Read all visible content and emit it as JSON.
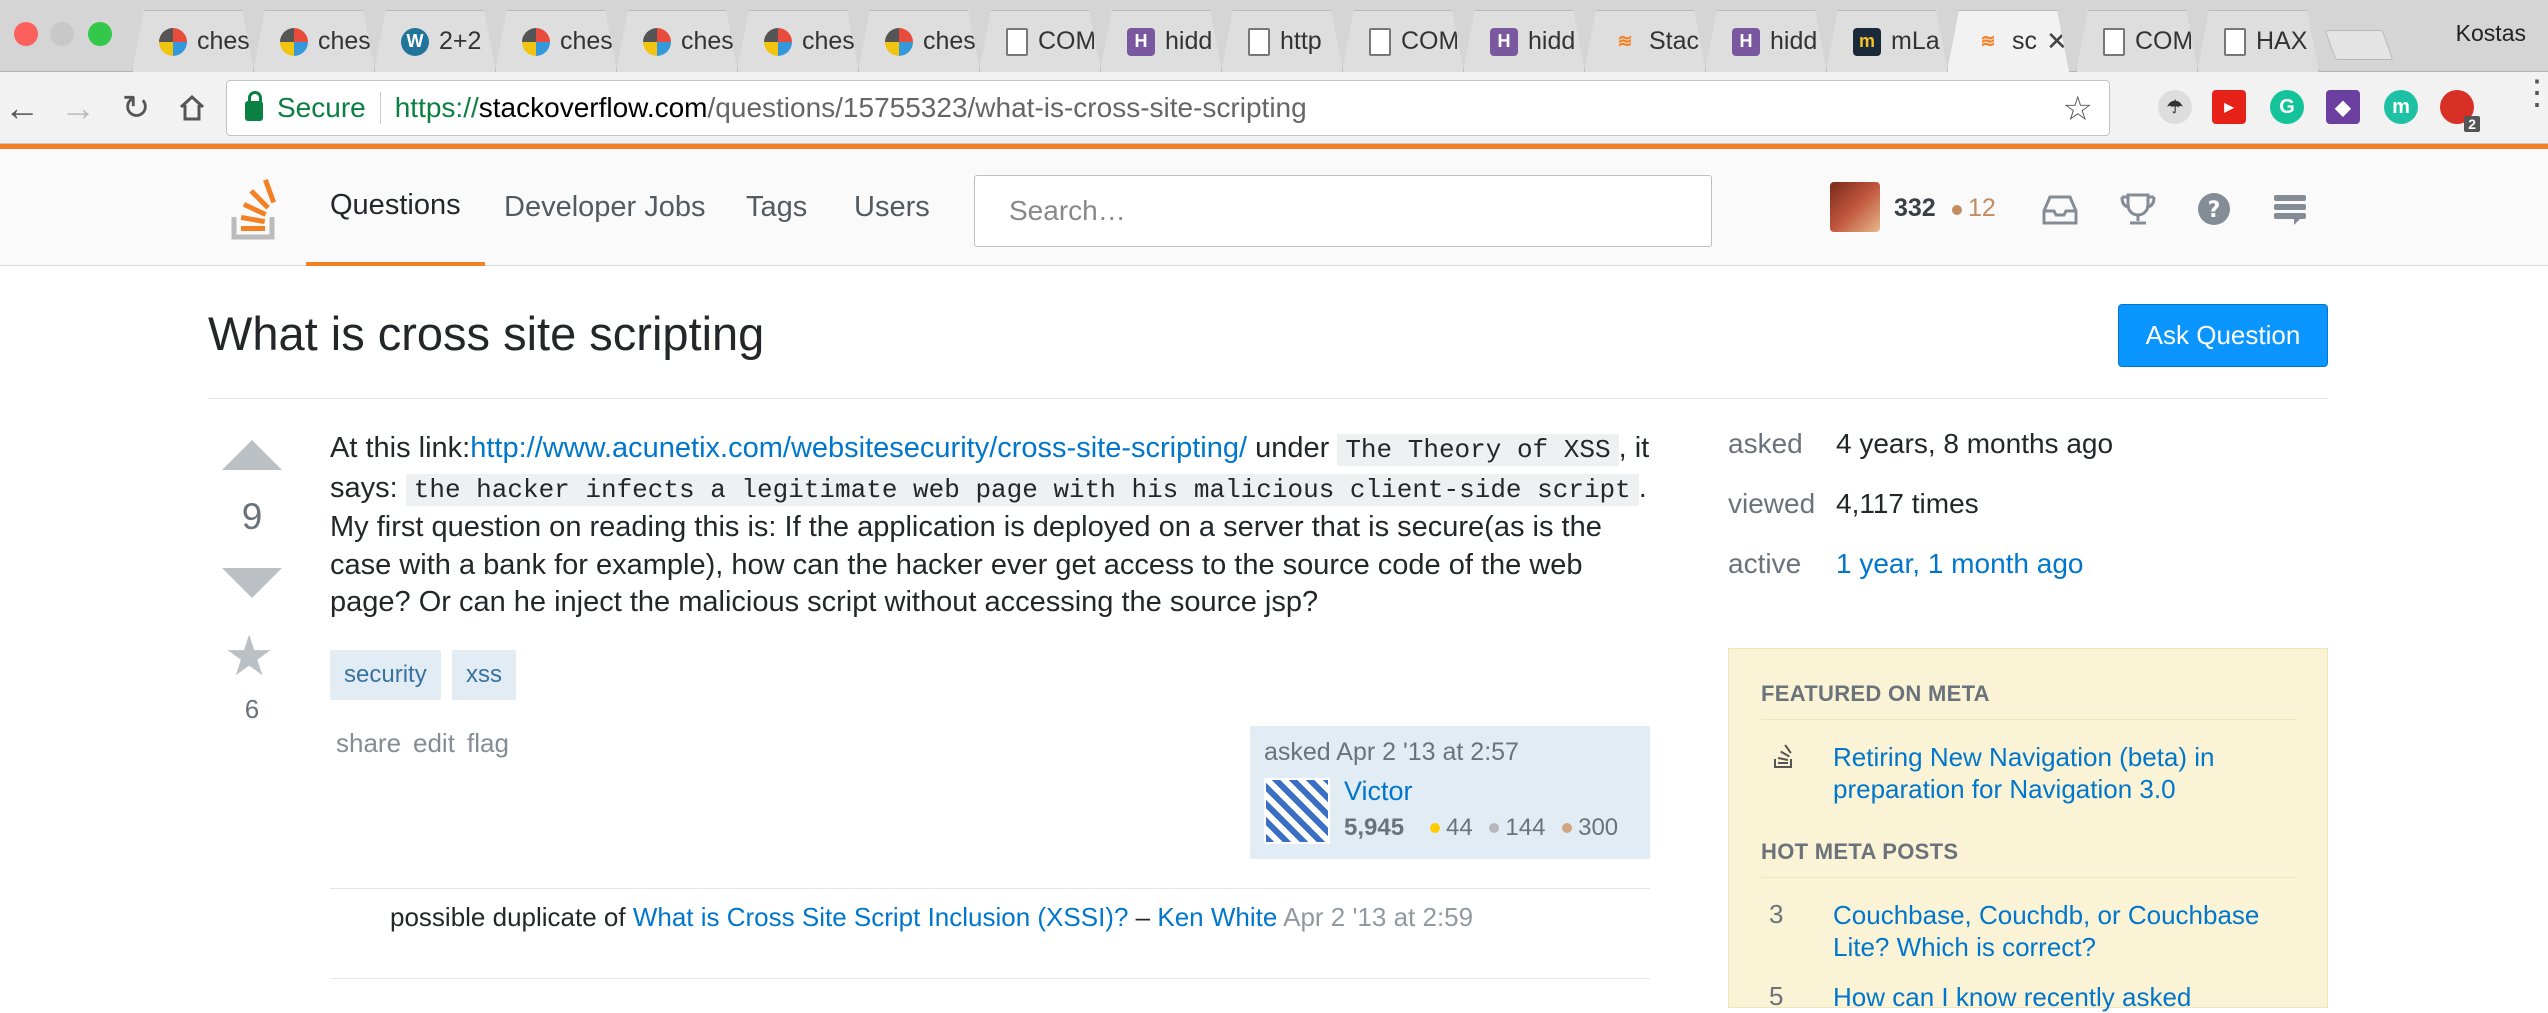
{
  "browser": {
    "tabs": [
      {
        "title": "ches",
        "favicon": "chess-pinwheel-icon",
        "color": "#8a8a8a"
      },
      {
        "title": "ches",
        "favicon": "chess-pinwheel-icon",
        "color": "#8a8a8a"
      },
      {
        "title": "2+2",
        "favicon": "wordpress-icon",
        "color": "#21759b"
      },
      {
        "title": "ches",
        "favicon": "chess-pinwheel-icon",
        "color": "#8a8a8a"
      },
      {
        "title": "ches",
        "favicon": "chess-pinwheel-icon",
        "color": "#8a8a8a"
      },
      {
        "title": "ches",
        "favicon": "chess-pinwheel-icon",
        "color": "#8a8a8a"
      },
      {
        "title": "ches",
        "favicon": "chess-pinwheel-icon",
        "color": "#8a8a8a"
      },
      {
        "title": "COM",
        "favicon": "document-icon",
        "color": "#ffffff"
      },
      {
        "title": "hidd",
        "favicon": "heroku-icon",
        "color": "#79589f"
      },
      {
        "title": "http",
        "favicon": "document-icon",
        "color": "#ffffff"
      },
      {
        "title": "COM",
        "favicon": "document-icon",
        "color": "#ffffff"
      },
      {
        "title": "hidd",
        "favicon": "heroku-icon",
        "color": "#79589f"
      },
      {
        "title": "Stac",
        "favicon": "stackoverflow-icon",
        "color": "#f48024"
      },
      {
        "title": "hidd",
        "favicon": "heroku-icon",
        "color": "#79589f"
      },
      {
        "title": "mLa",
        "favicon": "mlab-icon",
        "color": "#1b2a3a"
      },
      {
        "title": "sc",
        "favicon": "stackoverflow-icon",
        "color": "#f48024",
        "active": true
      },
      {
        "title": "COM",
        "favicon": "document-icon",
        "color": "#ffffff"
      },
      {
        "title": "HAX",
        "favicon": "document-icon",
        "color": "#ffffff"
      }
    ],
    "active_tab_close": "✕",
    "profile_name": "Kostas",
    "secure_label": "Secure",
    "url_scheme": "https://",
    "url_host": "stackoverflow.com",
    "url_path": "/questions/15755323/what-is-cross-site-scripting",
    "extension_badge": "2"
  },
  "so": {
    "nav": {
      "questions": "Questions",
      "jobs": "Developer Jobs",
      "tags": "Tags",
      "users": "Users"
    },
    "search_placeholder": "Search…",
    "reputation": "332",
    "bronze_badges": "12",
    "accent": "#f48024",
    "link_color": "#0077cc"
  },
  "question": {
    "title": "What is cross site scripting",
    "ask_button": "Ask Question",
    "votes": "9",
    "favorites": "6",
    "body": {
      "p1_lead": "At this link:",
      "p1_link": "http://www.acunetix.com/websitesecurity/cross-site-scripting/",
      "p1_under": " under ",
      "p1_code1": "The Theory of XSS",
      "p1_says": ", it says: ",
      "p1_code2": "the hacker infects a legitimate web page with his malicious client-side script",
      "p1_rest": ". My first question on reading this is: If the application is deployed on a server that is secure(as is the case with a bank for example), how can the hacker ever get access to the source code of the web page? Or can he inject the malicious script without accessing the source jsp?"
    },
    "tags": [
      "security",
      "xss"
    ],
    "menu": {
      "share": "share",
      "edit": "edit",
      "flag": "flag"
    },
    "asked": "asked Apr 2 '13 at 2:57",
    "user": {
      "name": "Victor",
      "rep": "5,945",
      "gold": "44",
      "silver": "144",
      "bronze": "300"
    },
    "comment": {
      "text": "possible duplicate of ",
      "link": "What is Cross Site Script Inclusion (XSSI)?",
      "dash": " – ",
      "author": "Ken White",
      "date": " Apr 2 '13 at 2:59"
    }
  },
  "sidebar": {
    "stats": [
      {
        "label": "asked",
        "value": "4 years, 8 months ago"
      },
      {
        "label": "viewed",
        "value": "4,117 times"
      },
      {
        "label": "active",
        "value": "1 year, 1 month ago"
      }
    ],
    "featured_heading": "FEATURED ON META",
    "featured_link": "Retiring New Navigation (beta) in preparation for Navigation 3.0",
    "hot_heading": "HOT META POSTS",
    "hot_posts": [
      {
        "count": "3",
        "title": "Couchbase, Couchdb, or Couchbase Lite? Which is correct?"
      },
      {
        "count": "5",
        "title": "How can I know recently asked"
      }
    ]
  }
}
